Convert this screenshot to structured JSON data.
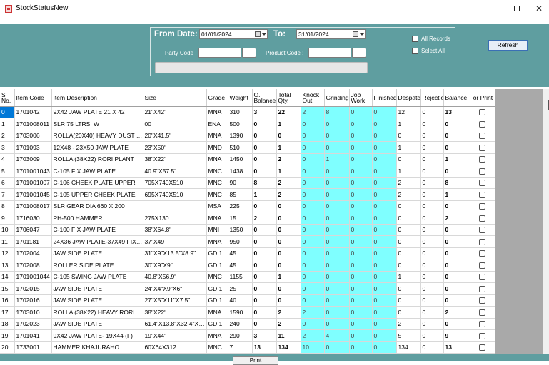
{
  "window": {
    "title": "StockStatusNew"
  },
  "filters": {
    "from_date_label": "From Date:",
    "from_date_value": "01/01/2024",
    "to_label": "To:",
    "to_date_value": "31/01/2024",
    "party_code_label": "Party Code :",
    "product_code_label": "Product Code :",
    "all_records_label": "All Records",
    "select_all_label": "Select All",
    "refresh_label": "Refresh"
  },
  "grid": {
    "columns": [
      "Sl No.",
      "Item Code",
      "Item Description",
      "Size",
      "Grade",
      "Weight",
      "O. Balance",
      "Total Qty.",
      "Knock Out",
      "Grinding",
      "Job Work",
      "Finished",
      "Despatch",
      "Rejection",
      "Balance",
      "For Print"
    ],
    "rows": [
      [
        "0",
        "1701042",
        "9X42 JAW PLATE 21 X 42",
        "21\"X42\"",
        "MNA",
        "310",
        "3",
        "22",
        "2",
        "8",
        "0",
        "0",
        "12",
        "0",
        "13"
      ],
      [
        "1",
        "1701008011",
        "SLR 75 LTRS. W",
        "00",
        "ENA",
        "500",
        "0",
        "1",
        "0",
        "0",
        "0",
        "0",
        "1",
        "0",
        "0"
      ],
      [
        "2",
        "1703006",
        "ROLLA(20X40) HEAVY DUST PLATE",
        "20\"X41.5\"",
        "MNA",
        "1390",
        "0",
        "0",
        "0",
        "0",
        "0",
        "0",
        "0",
        "0",
        "0"
      ],
      [
        "3",
        "1701093",
        "12X48 - 23X50 JAW PLATE",
        "23\"X50\"",
        "MND",
        "510",
        "0",
        "1",
        "0",
        "0",
        "0",
        "0",
        "1",
        "0",
        "0"
      ],
      [
        "4",
        "1703009",
        "ROLLA (38X22) RORI PLANT",
        "38\"X22\"",
        "MNA",
        "1450",
        "0",
        "2",
        "0",
        "1",
        "0",
        "0",
        "0",
        "0",
        "1"
      ],
      [
        "5",
        "1701001043",
        "C-105 FIX JAW PLATE",
        "40.9\"X57.5\"",
        "MNC",
        "1438",
        "0",
        "1",
        "0",
        "0",
        "0",
        "0",
        "1",
        "0",
        "0"
      ],
      [
        "6",
        "1701001007",
        "C-106 CHEEK PLATE UPPER",
        "705X740X510",
        "MNC",
        "90",
        "8",
        "2",
        "0",
        "0",
        "0",
        "0",
        "2",
        "0",
        "8"
      ],
      [
        "7",
        "1701001045",
        "C-105 UPPER CHEEK PLATE",
        "695X740X510",
        "MNC",
        "85",
        "1",
        "2",
        "0",
        "0",
        "0",
        "0",
        "2",
        "0",
        "1"
      ],
      [
        "8",
        "1701008017",
        "SLR GEAR DIA 660 X 200",
        "",
        "MSA",
        "225",
        "0",
        "0",
        "0",
        "0",
        "0",
        "0",
        "0",
        "0",
        "0"
      ],
      [
        "9",
        "1716030",
        "PH-500 HAMMER",
        "275X130",
        "MNA",
        "15",
        "2",
        "0",
        "0",
        "0",
        "0",
        "0",
        "0",
        "0",
        "2"
      ],
      [
        "10",
        "1706047",
        "C-100 FIX JAW PLATE",
        "38\"X64.8\"",
        "MNI",
        "1350",
        "0",
        "0",
        "0",
        "0",
        "0",
        "0",
        "0",
        "0",
        "0"
      ],
      [
        "11",
        "1701181",
        "24X36 JAW PLATE-37X49 FIXED",
        "37\"X49",
        "MNA",
        "950",
        "0",
        "0",
        "0",
        "0",
        "0",
        "0",
        "0",
        "0",
        "0"
      ],
      [
        "12",
        "1702004",
        "JAW SIDE PLATE",
        "31\"X9\"X13.5\"X8.9\"",
        "GD 1",
        "45",
        "0",
        "0",
        "0",
        "0",
        "0",
        "0",
        "0",
        "0",
        "0"
      ],
      [
        "13",
        "1702008",
        "ROLLER SIDE PLATE",
        "30\"X9\"X9\"",
        "GD 1",
        "45",
        "0",
        "0",
        "0",
        "0",
        "0",
        "0",
        "0",
        "0",
        "0"
      ],
      [
        "14",
        "1701001044",
        "C-105 SWING JAW PLATE",
        "40.8\"X56.9\"",
        "MNC",
        "1155",
        "0",
        "1",
        "0",
        "0",
        "0",
        "0",
        "1",
        "0",
        "0"
      ],
      [
        "15",
        "1702015",
        "JAW SIDE PLATE",
        "24\"X4\"X9\"X6\"",
        "GD 1",
        "25",
        "0",
        "0",
        "0",
        "0",
        "0",
        "0",
        "0",
        "0",
        "0"
      ],
      [
        "16",
        "1702016",
        "JAW SIDE PLATE",
        "27\"X5\"X11\"X7.5\"",
        "GD 1",
        "40",
        "0",
        "0",
        "0",
        "0",
        "0",
        "0",
        "0",
        "0",
        "0"
      ],
      [
        "17",
        "1703010",
        "ROLLA (38X22) HEAVY RORI PLANT",
        "38\"X22\"",
        "MNA",
        "1590",
        "0",
        "2",
        "2",
        "0",
        "0",
        "0",
        "0",
        "0",
        "2"
      ],
      [
        "18",
        "1702023",
        "JAW SIDE PLATE",
        "61.4\"X13.8\"X32.4\"X25\"",
        "GD 1",
        "240",
        "0",
        "2",
        "0",
        "0",
        "0",
        "0",
        "2",
        "0",
        "0"
      ],
      [
        "19",
        "1701041",
        "9X42 JAW PLATE- 19X44 (F)",
        "19\"X44\"",
        "MNA",
        "290",
        "3",
        "11",
        "2",
        "4",
        "0",
        "0",
        "5",
        "0",
        "9"
      ],
      [
        "20",
        "1733001",
        "HAMMER KHAJURAHO",
        "60X64X312",
        "MNC",
        "7",
        "13",
        "134",
        "10",
        "0",
        "0",
        "0",
        "134",
        "0",
        "13"
      ]
    ]
  },
  "footer": {
    "print_label": "Print"
  }
}
